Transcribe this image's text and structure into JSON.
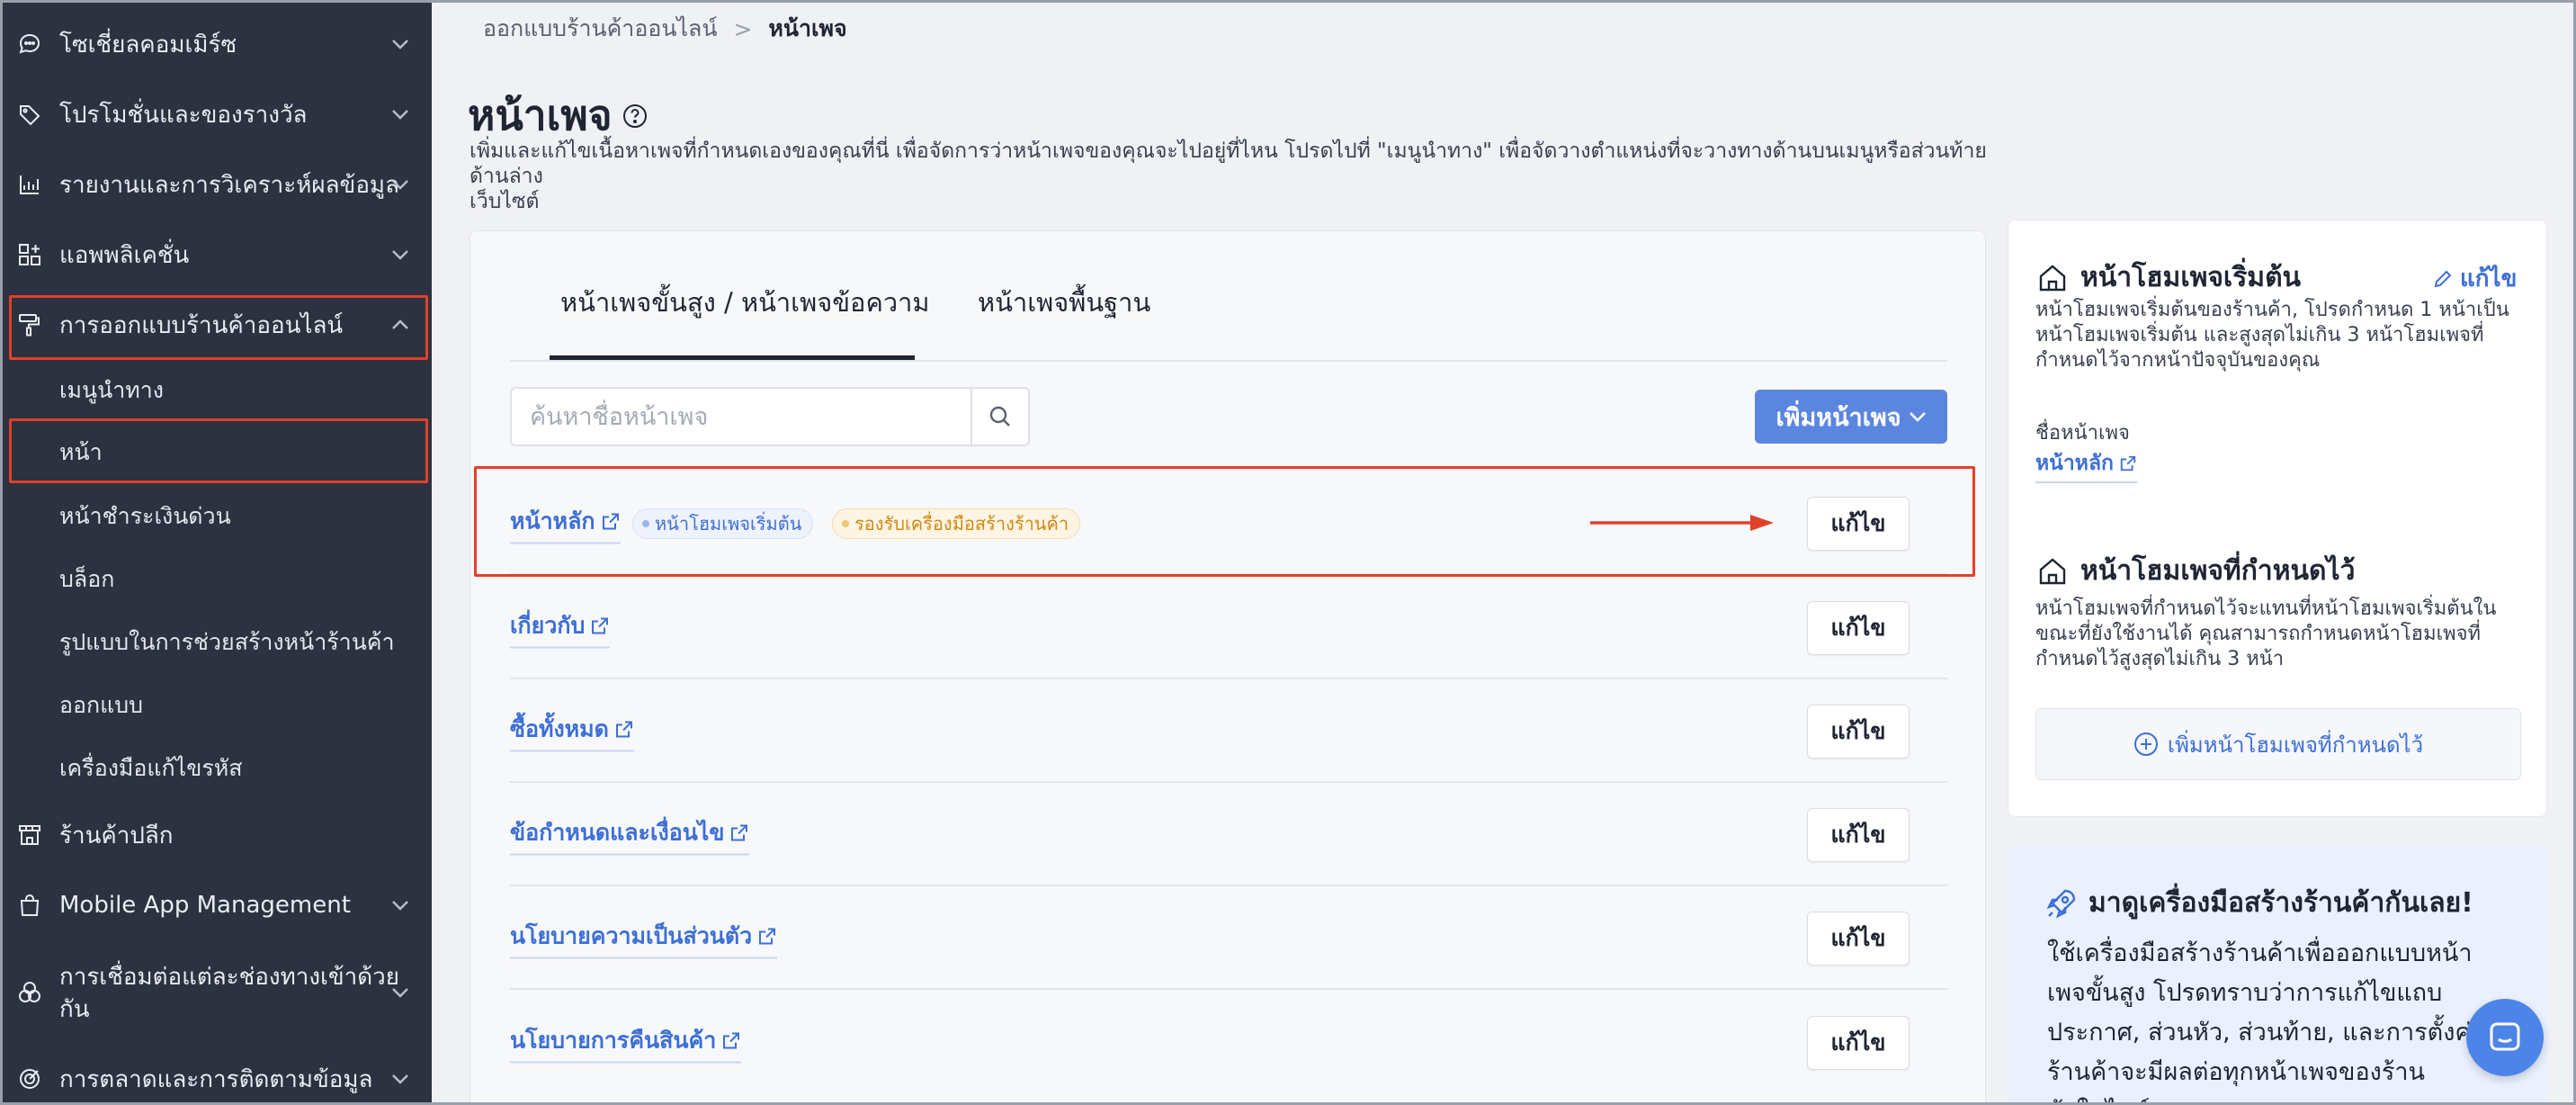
{
  "sidebar": {
    "items": [
      {
        "label": "โซเชี่ยลคอมเมิร์ซ",
        "icon": "chat-bubble-icon"
      },
      {
        "label": "โปรโมชั่นและของรางวัล",
        "icon": "tag-icon"
      },
      {
        "label": "รายงานและการวิเคราะห์ผลข้อมูล",
        "icon": "chart-icon"
      },
      {
        "label": "แอพพลิเคชั่น",
        "icon": "apps-icon"
      },
      {
        "label": "การออกแบบร้านค้าออนไลน์",
        "icon": "paint-roller-icon"
      }
    ],
    "subitems": [
      {
        "label": "เมนูนำทาง"
      },
      {
        "label": "หน้า"
      },
      {
        "label": "หน้าชำระเงินด่วน"
      },
      {
        "label": "บล็อก"
      },
      {
        "label": "รูปแบบในการช่วยสร้างหน้าร้านค้า"
      },
      {
        "label": "ออกแบบ"
      },
      {
        "label": "เครื่องมือแก้ไขรหัส"
      }
    ],
    "bottom_items": [
      {
        "label": "ร้านค้าปลีก",
        "icon": "store-icon"
      },
      {
        "label": "Mobile App Management",
        "icon": "shopping-bag-icon"
      },
      {
        "label": "การเชื่อมต่อแต่ละช่องทางเข้าด้วยกัน",
        "label_line1": "การเชื่อมต่อแต่ละช่องทางเข้าด้วย",
        "label_line2": "กัน",
        "icon": "channels-icon"
      },
      {
        "label": "การตลาดและการติดตามข้อมูล",
        "icon": "target-icon"
      }
    ]
  },
  "breadcrumb": {
    "parent": "ออกแบบร้านค้าออนไลน์",
    "separator": ">",
    "current": "หน้าเพจ"
  },
  "page": {
    "title": "หน้าเพจ",
    "description_line1": "เพิ่มและแก้ไขเนื้อหาเพจที่กำหนดเองของคุณที่นี่ เพื่อจัดการว่าหน้าเพจของคุณจะไปอยู่ที่ไหน โปรดไปที่ \"เมนูนำทาง\" เพื่อจัดวางตำแหน่งที่จะวางทางด้านบนเมนูหรือส่วนท้ายด้านล่าง",
    "description_line2": "เว็บไซต์"
  },
  "tabs": [
    {
      "label": "หน้าเพจขั้นสูง / หน้าเพจข้อความ",
      "active": true
    },
    {
      "label": "หน้าเพจพื้นฐาน",
      "active": false
    }
  ],
  "search": {
    "placeholder": "ค้นหาชื่อหน้าเพจ",
    "value": ""
  },
  "add_button": {
    "label": "เพิ่มหน้าเพจ"
  },
  "pages": [
    {
      "name": "หน้าหลัก",
      "badges": [
        "หน้าโฮมเพจเริ่มต้น",
        "รองรับเครื่องมือสร้างร้านค้า"
      ],
      "edit_label": "แก้ไข"
    },
    {
      "name": "เกี่ยวกับ",
      "badges": [],
      "edit_label": "แก้ไข"
    },
    {
      "name": "ซื้อทั้งหมด",
      "badges": [],
      "edit_label": "แก้ไข"
    },
    {
      "name": "ข้อกำหนดและเงื่อนไข",
      "badges": [],
      "edit_label": "แก้ไข"
    },
    {
      "name": "นโยบายความเป็นส่วนตัว",
      "badges": [],
      "edit_label": "แก้ไข"
    },
    {
      "name": "นโยบายการคืนสินค้า",
      "badges": [],
      "edit_label": "แก้ไข"
    }
  ],
  "right_panel": {
    "default_home": {
      "title": "หน้าโฮมเพจเริ่มต้น",
      "edit_label": "แก้ไข",
      "desc_line1": "หน้าโฮมเพจเริ่มต้นของร้านค้า, โปรดกำหนด 1 หน้าเป็น",
      "desc_line2": "หน้าโฮมเพจเริ่มต้น และสูงสุดไม่เกิน 3 หน้าโฮมเพจที่",
      "desc_line3": "กำหนดไว้จากหน้าปัจจุบันของคุณ",
      "page_name_label": "ชื่อหน้าเพจ",
      "page_name_value": "หน้าหลัก"
    },
    "custom_home": {
      "title": "หน้าโฮมเพจที่กำหนดไว้",
      "desc_line1": "หน้าโฮมเพจที่กำหนดไว้จะแทนที่หน้าโฮมเพจเริ่มต้นใน",
      "desc_line2": "ขณะที่ยังใช้งานได้ คุณสามารถกำหนดหน้าโฮมเพจที่",
      "desc_line3": "กำหนดไว้สูงสุดไม่เกิน 3 หน้า",
      "add_label": "เพิ่มหน้าโฮมเพจที่กำหนดไว้"
    }
  },
  "promo": {
    "title": "มาดูเครื่องมือสร้างร้านค้ากันเลย!",
    "line1": "ใช้เครื่องมือสร้างร้านค้าเพื่อออกแบบหน้า",
    "line2": "เพจขั้นสูง โปรดทราบว่าการแก้ไขแถบ",
    "line3": "ประกาศ, ส่วนหัว, ส่วนท้าย, และการตั้งค่",
    "line4": "ร้านค้าจะมีผลต่อทุกหน้าเพจของร้าน",
    "line5": "ค้าในไซต์"
  },
  "colors": {
    "sidebar_bg": "#2c3240",
    "accent": "#5b86e0",
    "link": "#3d6fd6",
    "highlight": "#e0412b"
  }
}
